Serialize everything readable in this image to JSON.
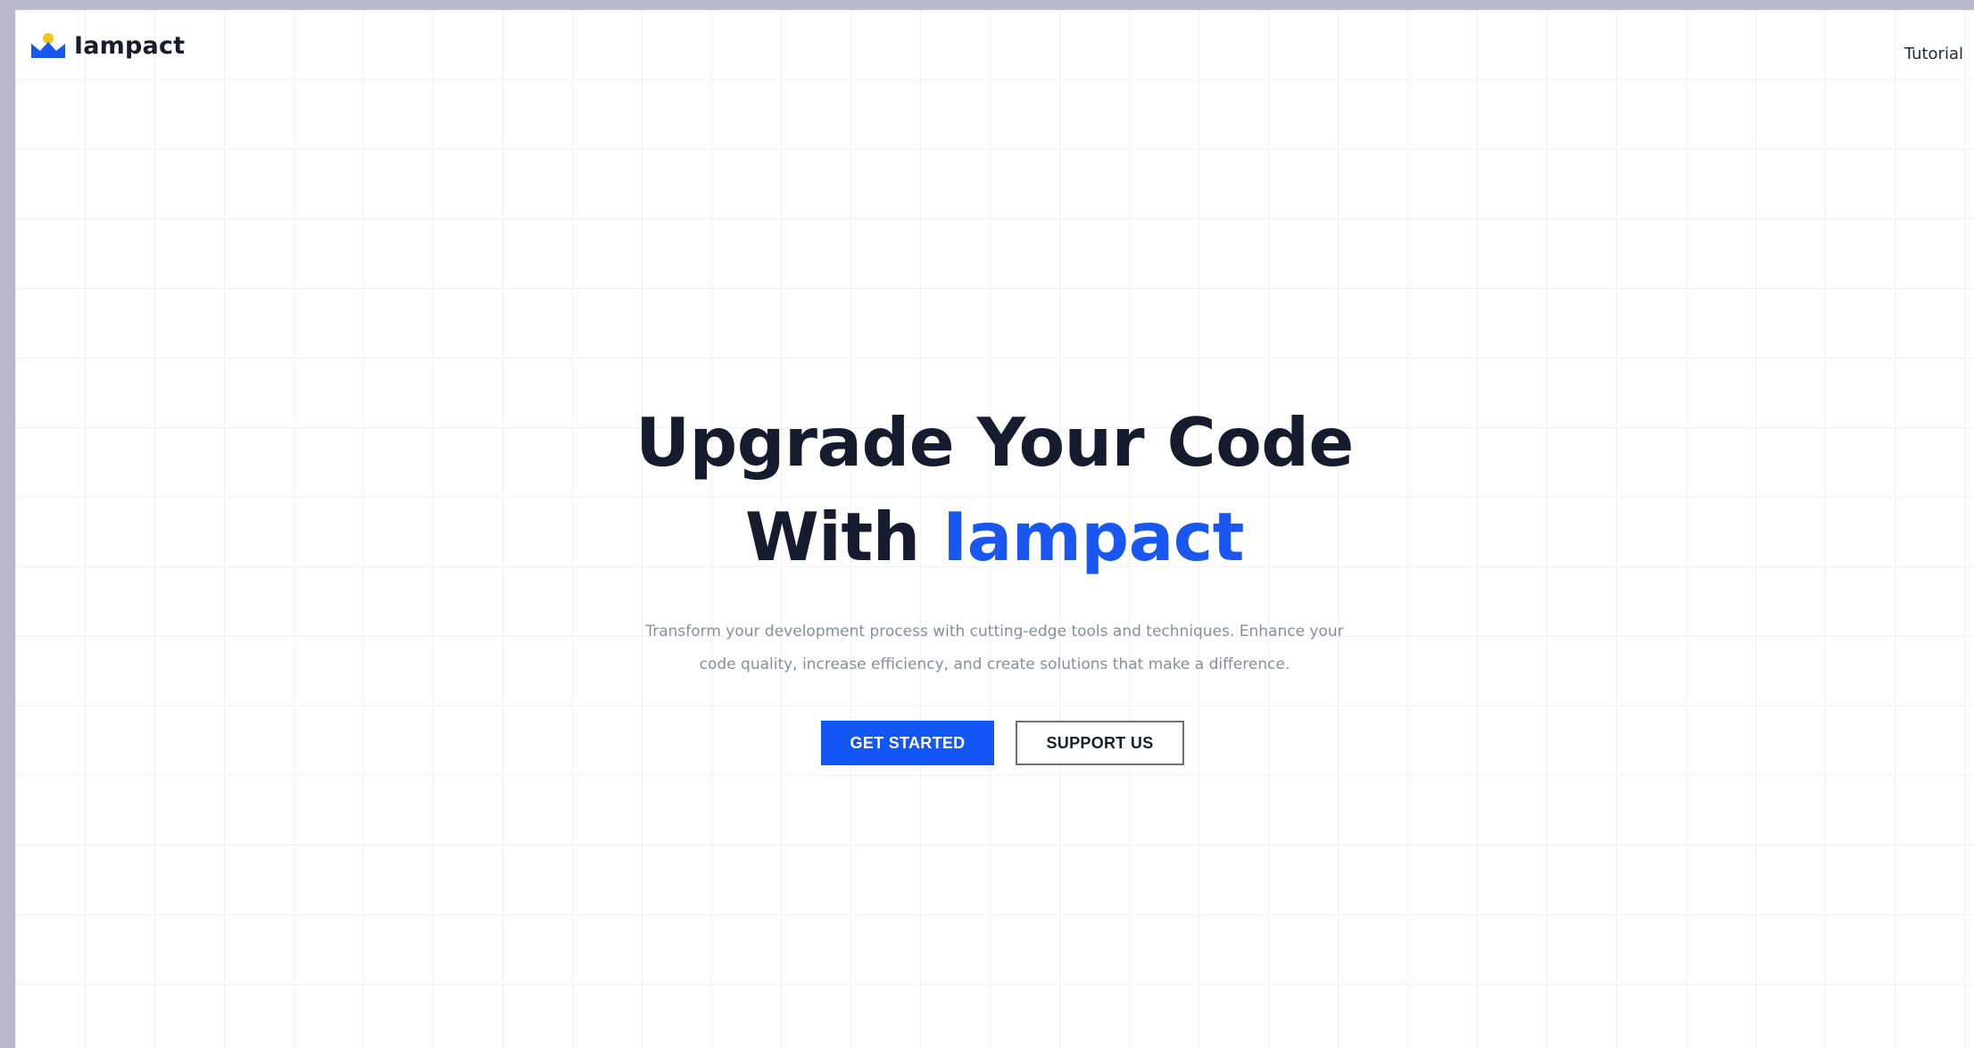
{
  "header": {
    "brand": "Iampact",
    "nav_link": "Tutorial"
  },
  "hero": {
    "title_line1": "Upgrade Your Code",
    "title_line2_prefix": "With",
    "title_line2_accent": "Iampact",
    "subtitle_line1": "Transform your development process with cutting-edge tools and techniques. Enhance your",
    "subtitle_line2": "code quality, increase efficiency, and create solutions that make a difference.",
    "primary_button": "GET STARTED",
    "secondary_button": "SUPPORT US"
  },
  "colors": {
    "accent": "#1256f5",
    "heading": "#161b2e",
    "logo_yellow": "#f5c518",
    "logo_blue": "#1a56f0"
  },
  "icons": {
    "logo": "crown-logo-icon"
  }
}
